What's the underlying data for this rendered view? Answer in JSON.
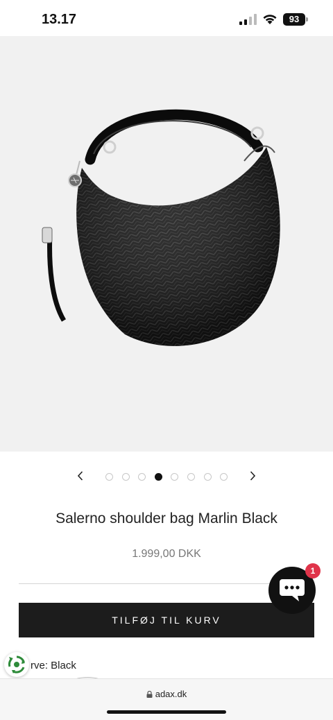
{
  "status_bar": {
    "time": "13.17",
    "battery": "93"
  },
  "product": {
    "image_alt": "Salerno shoulder bag Marlin Black",
    "title": "Salerno shoulder bag Marlin Black",
    "price": "1.999,00 DKK",
    "add_to_cart_label": "TILFØJ TIL KURV",
    "color_label": "rve: Black"
  },
  "carousel": {
    "total_slides": 8,
    "active_index": 3
  },
  "chat": {
    "unread_count": "1"
  },
  "browser": {
    "url": "adax.dk"
  },
  "colors": {
    "button_bg": "#1c1c1c",
    "badge": "#e0344a",
    "image_bg": "#f1f1f1"
  }
}
